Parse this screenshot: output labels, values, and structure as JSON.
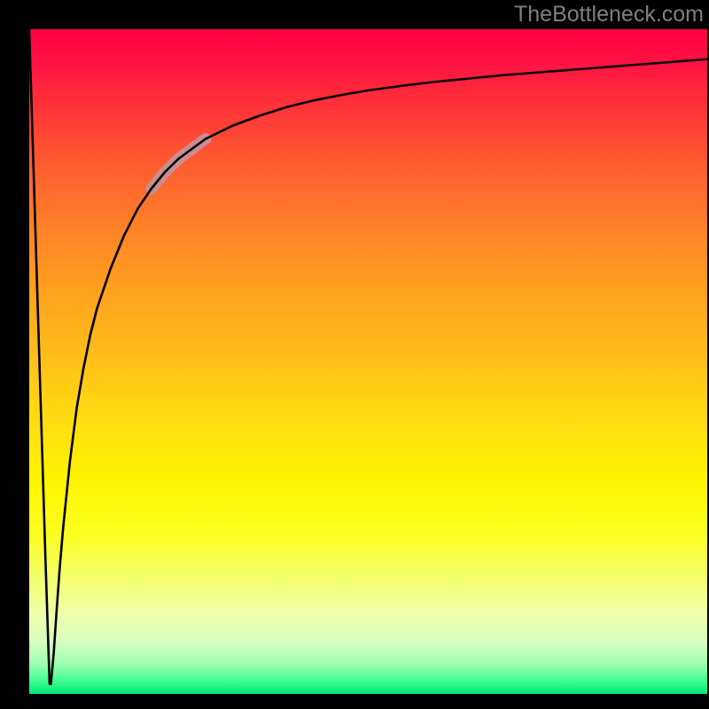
{
  "watermark": "TheBottleneck.com",
  "colors": {
    "frame": "#000000",
    "watermark": "#7f7f7f",
    "curve_main": "#000000",
    "curve_faded": "#c98e8f"
  },
  "gradient": {
    "stops": [
      {
        "offset": 0.0,
        "color": "#ff0040"
      },
      {
        "offset": 0.05,
        "color": "#ff1243"
      },
      {
        "offset": 0.1,
        "color": "#ff2b3a"
      },
      {
        "offset": 0.2,
        "color": "#ff5a30"
      },
      {
        "offset": 0.3,
        "color": "#ff8228"
      },
      {
        "offset": 0.4,
        "color": "#ffa31e"
      },
      {
        "offset": 0.5,
        "color": "#ffc018"
      },
      {
        "offset": 0.6,
        "color": "#ffe010"
      },
      {
        "offset": 0.68,
        "color": "#fff400"
      },
      {
        "offset": 0.76,
        "color": "#fbff20"
      },
      {
        "offset": 0.82,
        "color": "#f4ff66"
      },
      {
        "offset": 0.88,
        "color": "#eeffaa"
      },
      {
        "offset": 0.92,
        "color": "#d8ffc0"
      },
      {
        "offset": 0.955,
        "color": "#9effb0"
      },
      {
        "offset": 0.98,
        "color": "#40ff90"
      },
      {
        "offset": 1.0,
        "color": "#00e878"
      }
    ]
  },
  "chart_data": {
    "type": "line",
    "title": "",
    "xlabel": "",
    "ylabel": "",
    "xlim": [
      0,
      100
    ],
    "ylim": [
      0,
      100
    ],
    "faded_segment_x": [
      18,
      26
    ],
    "note": "The curve drops from (0,100) to a sharp valley bottom at x≈3, y≈1, then rises asymptotically toward y≈96.",
    "series": [
      {
        "name": "curve",
        "x": [
          0,
          0.6,
          1.2,
          1.8,
          2.4,
          3,
          3.2,
          3.6,
          4,
          4.5,
          5,
          6,
          7,
          8,
          9,
          10,
          12,
          14,
          16,
          18,
          20,
          22,
          24,
          26,
          28,
          30,
          34,
          38,
          42,
          46,
          50,
          55,
          60,
          65,
          70,
          75,
          80,
          85,
          90,
          95,
          100
        ],
        "y": [
          100,
          80,
          60,
          40,
          20,
          1.5,
          1.5,
          6,
          12,
          19,
          25,
          35,
          43,
          49,
          54,
          58,
          64,
          69,
          73,
          76,
          78.5,
          80.5,
          82,
          83.5,
          84.5,
          85.5,
          87,
          88.3,
          89.3,
          90.1,
          90.8,
          91.5,
          92.1,
          92.6,
          93.1,
          93.5,
          93.9,
          94.3,
          94.7,
          95.1,
          95.5
        ]
      }
    ]
  }
}
